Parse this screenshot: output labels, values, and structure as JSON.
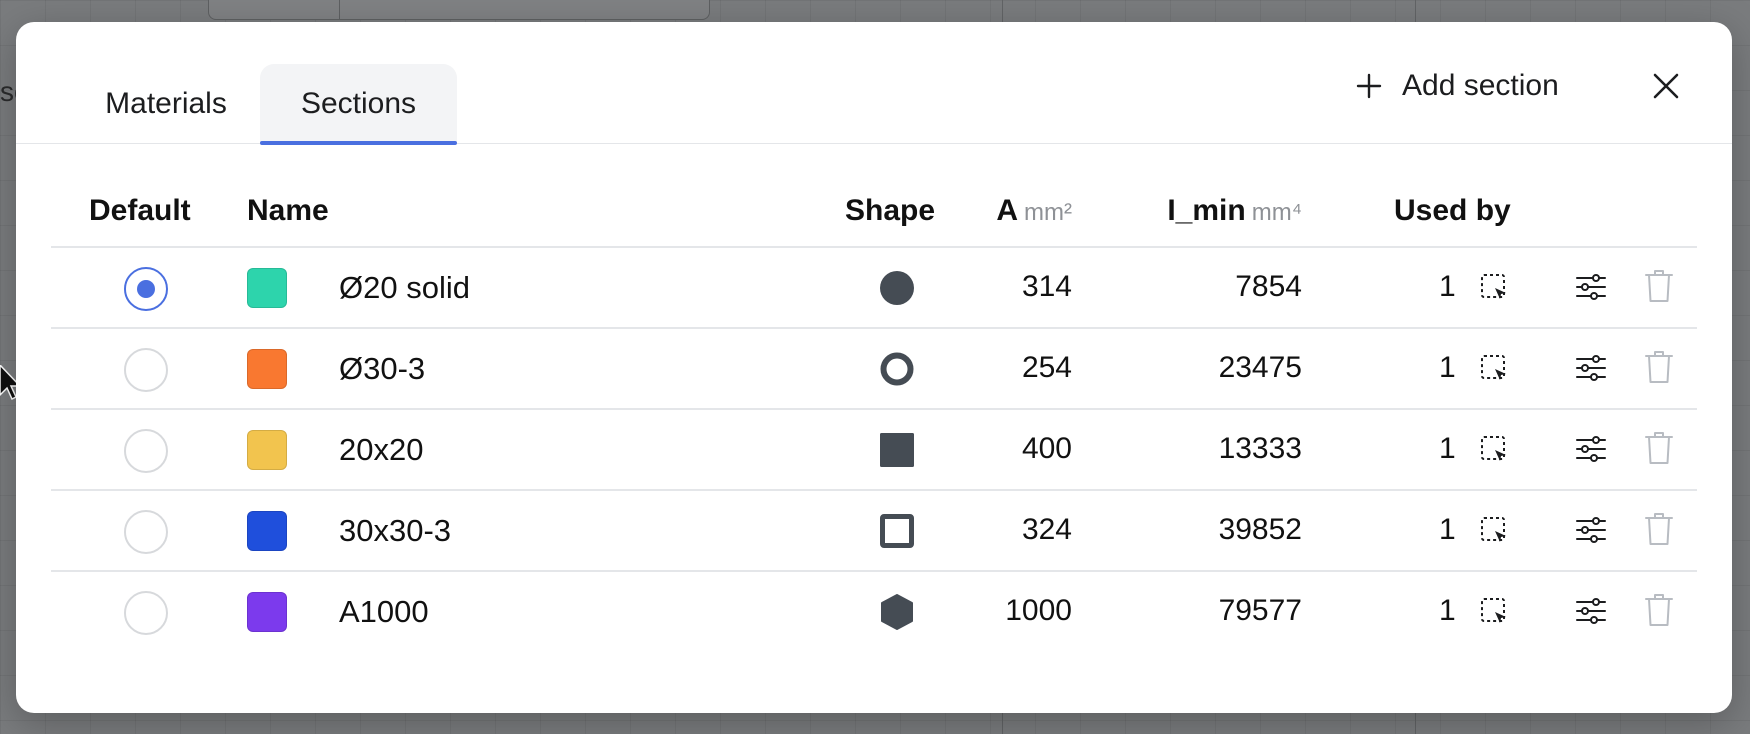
{
  "background": {
    "edge_text": "se"
  },
  "tabs": [
    {
      "label": "Materials",
      "active": false
    },
    {
      "label": "Sections",
      "active": true
    }
  ],
  "header": {
    "add_label": "Add section"
  },
  "columns": {
    "default": "Default",
    "name": "Name",
    "shape": "Shape",
    "a": "A",
    "a_unit": "mm²",
    "imin": "I_min",
    "imin_unit": "mm⁴",
    "used_by": "Used by"
  },
  "rows": [
    {
      "name": "Ø20 solid",
      "color": "#2dd4ac",
      "shape": "circle-solid-icon",
      "a": "314",
      "imin": "7854",
      "used_by": "1",
      "default": true
    },
    {
      "name": "Ø30-3",
      "color": "#f97830",
      "shape": "circle-hollow-icon",
      "a": "254",
      "imin": "23475",
      "used_by": "1",
      "default": false
    },
    {
      "name": "20x20",
      "color": "#f2c44e",
      "shape": "square-solid-icon",
      "a": "400",
      "imin": "13333",
      "used_by": "1",
      "default": false
    },
    {
      "name": "30x30-3",
      "color": "#1f4fdc",
      "shape": "square-hollow-icon",
      "a": "324",
      "imin": "39852",
      "used_by": "1",
      "default": false
    },
    {
      "name": "A1000",
      "color": "#7c3aed",
      "shape": "hexagon-icon",
      "a": "1000",
      "imin": "79577",
      "used_by": "1",
      "default": false
    }
  ],
  "colors": {
    "accent": "#4a6fe0",
    "shape_fill": "#454c54",
    "divider": "#e4e6e9"
  }
}
